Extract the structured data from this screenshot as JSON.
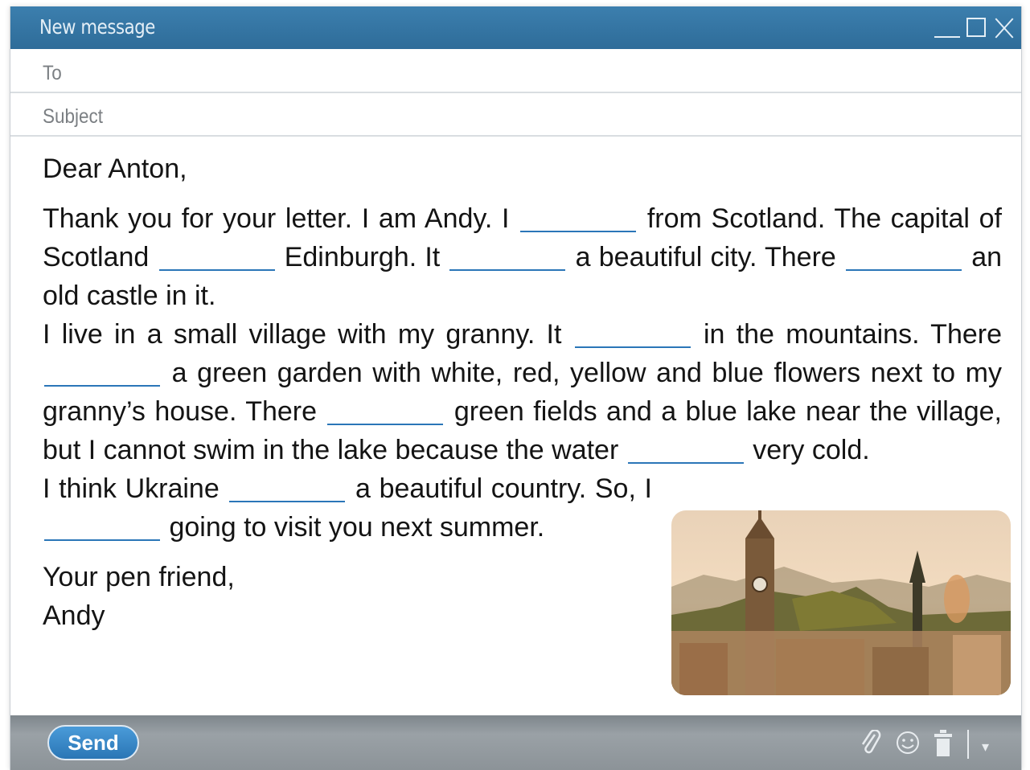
{
  "window": {
    "title": "New message",
    "controls": [
      "minimize",
      "maximize",
      "close"
    ]
  },
  "fields": {
    "to_label": "To",
    "subject_label": "Subject"
  },
  "letter": {
    "greeting": "Dear Anton,",
    "p1": [
      "Thank you for your letter. I am Andy. I ",
      " from Scotland. The capital of Scotland ",
      " Edinburgh. It ",
      " a beautiful city. There ",
      " an old castle in it."
    ],
    "p2": [
      "I live in a small village with my granny. It ",
      " in the mountains. There ",
      " a green garden with white, red, yellow and blue flowers next to my granny’s house. There ",
      " green fields and a blue lake near the village, but I cannot swim in the lake because the water ",
      " very cold."
    ],
    "p3": [
      "I think Ukraine ",
      " a beautiful country. So, I ",
      " going to visit you next summer."
    ],
    "closing": "Your pen friend,",
    "signature": "Andy",
    "blank": "_______"
  },
  "photo": {
    "subject": "Edinburgh city view with clock tower and monument"
  },
  "toolbar": {
    "send_label": "Send",
    "icons": [
      "paperclip-icon",
      "smiley-icon",
      "trash-icon",
      "dropdown-arrow-icon"
    ]
  }
}
